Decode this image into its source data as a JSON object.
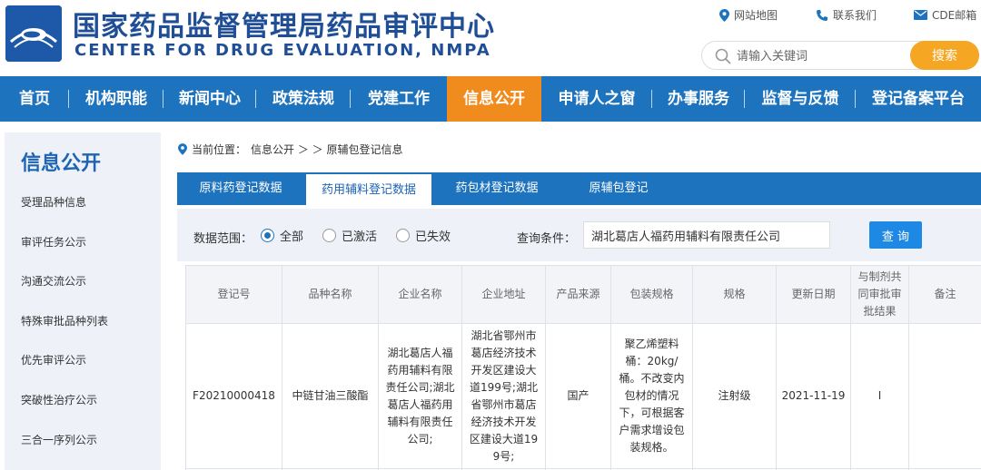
{
  "header": {
    "title_cn": "国家药品监督管理局药品审评中心",
    "title_en": "CENTER FOR DRUG EVALUATION, NMPA",
    "links": [
      "网站地图",
      "联系我们",
      "CDE邮箱"
    ],
    "search_placeholder": "请输入关键词",
    "search_button": "搜索"
  },
  "nav": {
    "items": [
      "首页",
      "机构职能",
      "新闻中心",
      "政策法规",
      "党建工作",
      "信息公开",
      "申请人之窗",
      "办事服务",
      "监督与反馈",
      "登记备案平台"
    ],
    "active": "信息公开"
  },
  "sidebar": {
    "title": "信息公开",
    "items": [
      "受理品种信息",
      "审评任务公示",
      "沟通交流公示",
      "特殊审批品种列表",
      "优先审评公示",
      "突破性治疗公示",
      "三合一序列公示"
    ]
  },
  "breadcrumb": {
    "prefix": "当前位置：",
    "path": "信息公开 ＞ ＞ 原辅包登记信息"
  },
  "tabs": [
    "原料药登记数据",
    "药用辅料登记数据",
    "药包材登记数据",
    "原辅包登记"
  ],
  "filter": {
    "range_label": "数据范围：",
    "options": [
      "全部",
      "已激活",
      "已失效"
    ],
    "selected": "全部",
    "condition_label": "查询条件：",
    "condition_value": "湖北葛店人福药用辅料有限责任公司",
    "query_button": "查 询"
  },
  "table": {
    "headers": [
      "登记号",
      "品种名称",
      "企业名称",
      "企业地址",
      "产品来源",
      "包装规格",
      "规格",
      "更新日期",
      "与制剂共同审批审批结果",
      "备注"
    ],
    "rows": [
      [
        "F20210000418",
        "中链甘油三酸酯",
        "湖北葛店人福药用辅料有限责任公司;湖北葛店人福药用辅料有限责任公司;",
        "湖北省鄂州市葛店经济技术开发区建设大道199号;湖北省鄂州市葛店经济技术开发区建设大道199号;",
        "国产",
        "聚乙烯塑料桶：20kg/桶。不改变内包材的情况下，可根据客户需求增设包装规格。",
        "注射级",
        "2021-11-19",
        "I",
        ""
      ]
    ]
  },
  "colors": {
    "nav_blue": "#1e73be",
    "active_orange": "#f08c1e",
    "search_orange": "#f5a623",
    "brand_dark_blue": "#1f4e96"
  }
}
